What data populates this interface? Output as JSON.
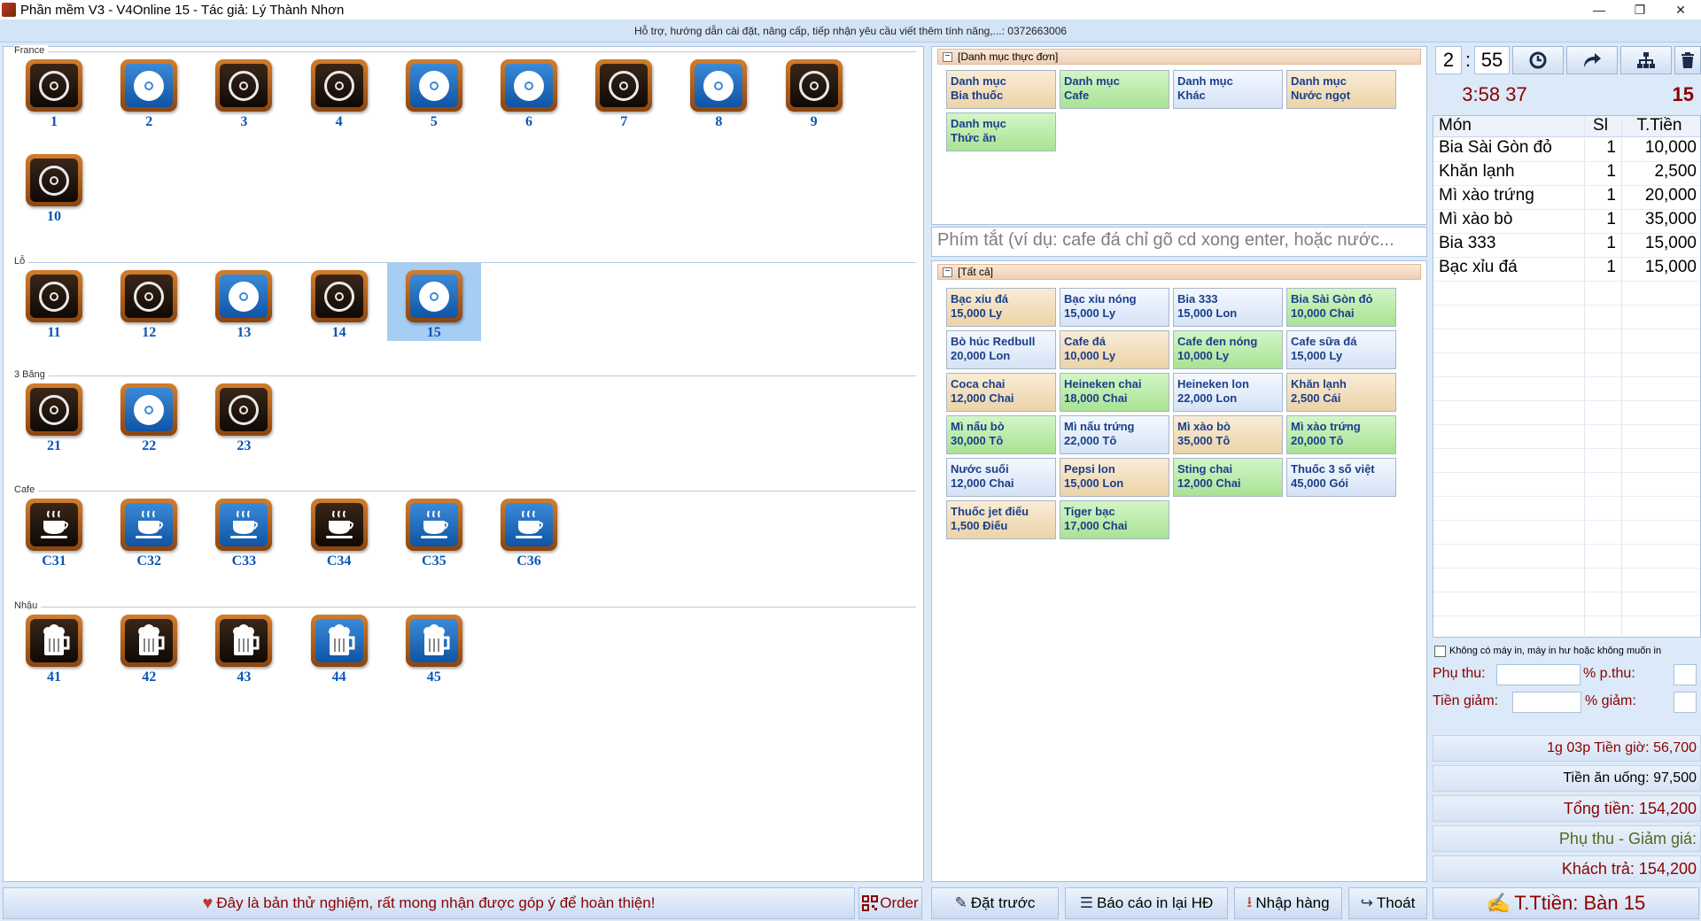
{
  "window": {
    "title": "Phần mềm V3 - V4Online 15 - Tác giả: Lý Thành Nhơn",
    "min_icon": "minimize-icon",
    "restore_icon": "restore-icon",
    "close_icon": "close-icon"
  },
  "infobar": {
    "text": "Hỗ trợ, hướng dẫn cài đặt, nâng cấp, tiếp nhận yêu cầu viết thêm tính năng,...: 0372663006"
  },
  "sections": [
    {
      "name": "France",
      "tables": [
        {
          "label": "1",
          "icon": "billiard-icon",
          "occupied": false
        },
        {
          "label": "2",
          "icon": "billiard-icon",
          "occupied": true
        },
        {
          "label": "3",
          "icon": "billiard-icon",
          "occupied": false
        },
        {
          "label": "4",
          "icon": "billiard-icon",
          "occupied": false
        },
        {
          "label": "5",
          "icon": "billiard-icon",
          "occupied": true
        },
        {
          "label": "6",
          "icon": "billiard-icon",
          "occupied": true
        },
        {
          "label": "7",
          "icon": "billiard-icon",
          "occupied": false
        },
        {
          "label": "8",
          "icon": "billiard-icon",
          "occupied": true
        },
        {
          "label": "9",
          "icon": "billiard-icon",
          "occupied": false
        },
        {
          "label": "10",
          "icon": "billiard-icon",
          "occupied": false
        }
      ]
    },
    {
      "name": "Lỗ",
      "tables": [
        {
          "label": "11",
          "icon": "billiard-icon",
          "occupied": false
        },
        {
          "label": "12",
          "icon": "billiard-icon",
          "occupied": false
        },
        {
          "label": "13",
          "icon": "billiard-icon",
          "occupied": true
        },
        {
          "label": "14",
          "icon": "billiard-icon",
          "occupied": false
        },
        {
          "label": "15",
          "icon": "billiard-icon",
          "occupied": true,
          "selected": true
        }
      ]
    },
    {
      "name": "3 Băng",
      "tables": [
        {
          "label": "21",
          "icon": "billiard-icon",
          "occupied": false
        },
        {
          "label": "22",
          "icon": "billiard-icon",
          "occupied": true
        },
        {
          "label": "23",
          "icon": "billiard-icon",
          "occupied": false
        }
      ]
    },
    {
      "name": "Cafe",
      "tables": [
        {
          "label": "C31",
          "icon": "coffee-cup-icon",
          "occupied": false
        },
        {
          "label": "C32",
          "icon": "coffee-cup-icon",
          "occupied": true
        },
        {
          "label": "C33",
          "icon": "coffee-cup-icon",
          "occupied": true
        },
        {
          "label": "C34",
          "icon": "coffee-cup-icon",
          "occupied": false
        },
        {
          "label": "C35",
          "icon": "coffee-cup-icon",
          "occupied": true
        },
        {
          "label": "C36",
          "icon": "coffee-cup-icon",
          "occupied": true
        }
      ]
    },
    {
      "name": "Nhậu",
      "tables": [
        {
          "label": "41",
          "icon": "beer-mug-icon",
          "occupied": false
        },
        {
          "label": "42",
          "icon": "beer-mug-icon",
          "occupied": false
        },
        {
          "label": "43",
          "icon": "beer-mug-icon",
          "occupied": false
        },
        {
          "label": "44",
          "icon": "beer-mug-icon",
          "occupied": true
        },
        {
          "label": "45",
          "icon": "beer-mug-icon",
          "occupied": true
        }
      ]
    }
  ],
  "menu_categories": {
    "header": "[Danh mục thực đơn]",
    "items": [
      {
        "line1": "Danh mục",
        "line2": "Bia thuốc",
        "color": "tan"
      },
      {
        "line1": "Danh mục",
        "line2": "Cafe",
        "color": "green"
      },
      {
        "line1": "Danh mục",
        "line2": "Khác",
        "color": "blue"
      },
      {
        "line1": "Danh mục",
        "line2": "Nước ngọt",
        "color": "tan"
      },
      {
        "line1": "Danh mục",
        "line2": "Thức ăn",
        "color": "green"
      }
    ]
  },
  "search": {
    "placeholder": "Phím tắt (ví dụ: cafe đá chỉ gõ cd xong enter, hoặc nước..."
  },
  "menu_items": {
    "header": "[Tất cả]",
    "items": [
      {
        "line1": "Bạc xỉu đá",
        "line2": "15,000 Ly",
        "color": "tan"
      },
      {
        "line1": "Bạc xỉu nóng",
        "line2": "15,000 Ly",
        "color": "blue"
      },
      {
        "line1": "Bia 333",
        "line2": "15,000 Lon",
        "color": "blue"
      },
      {
        "line1": "Bia Sài Gòn đỏ",
        "line2": "10,000 Chai",
        "color": "green"
      },
      {
        "line1": "Bò húc Redbull",
        "line2": "20,000 Lon",
        "color": "blue"
      },
      {
        "line1": "Cafe đá",
        "line2": "10,000 Ly",
        "color": "tan"
      },
      {
        "line1": "Cafe đen nóng",
        "line2": "10,000 Ly",
        "color": "green"
      },
      {
        "line1": "Cafe sữa đá",
        "line2": "15,000 Ly",
        "color": "blue"
      },
      {
        "line1": "Coca chai",
        "line2": "12,000 Chai",
        "color": "tan"
      },
      {
        "line1": "Heineken chai",
        "line2": "18,000 Chai",
        "color": "green"
      },
      {
        "line1": "Heineken lon",
        "line2": "22,000 Lon",
        "color": "blue"
      },
      {
        "line1": "Khăn lạnh",
        "line2": "2,500 Cái",
        "color": "tan"
      },
      {
        "line1": "Mì nấu bò",
        "line2": "30,000 Tô",
        "color": "green"
      },
      {
        "line1": "Mì nấu trứng",
        "line2": "22,000 Tô",
        "color": "blue"
      },
      {
        "line1": "Mì xào bò",
        "line2": "35,000 Tô",
        "color": "tan"
      },
      {
        "line1": "Mì xào trứng",
        "line2": "20,000 Tô",
        "color": "green"
      },
      {
        "line1": "Nước suối",
        "line2": "12,000 Chai",
        "color": "blue"
      },
      {
        "line1": "Pepsi lon",
        "line2": "15,000 Lon",
        "color": "tan"
      },
      {
        "line1": "Sting chai",
        "line2": "12,000 Chai",
        "color": "green"
      },
      {
        "line1": "Thuốc 3 số việt",
        "line2": "45,000 Gói",
        "color": "blue"
      },
      {
        "line1": "Thuốc jet điếu",
        "line2": "1,500 Điếu",
        "color": "tan"
      },
      {
        "line1": "Tiger bạc",
        "line2": "17,000 Chai",
        "color": "green"
      }
    ]
  },
  "timer": {
    "hours": "2",
    "sep": ":",
    "minutes": "55",
    "clock": "3:58 37",
    "table_number": "15"
  },
  "toolbar_icons": {
    "alarm": "alarm-clock-icon",
    "transfer": "transfer-arrow-icon",
    "merge": "merge-tables-icon",
    "delete": "trash-icon"
  },
  "order": {
    "headers": {
      "name": "Món",
      "qty": "Sl",
      "total": "T.Tiền"
    },
    "rows": [
      {
        "name": "Bia Sài Gòn đỏ",
        "qty": "1",
        "total": "10,000"
      },
      {
        "name": "Khăn lạnh",
        "qty": "1",
        "total": "2,500"
      },
      {
        "name": "Mì xào trứng",
        "qty": "1",
        "total": "20,000"
      },
      {
        "name": "Mì xào bò",
        "qty": "1",
        "total": "35,000"
      },
      {
        "name": "Bia 333",
        "qty": "1",
        "total": "15,000"
      },
      {
        "name": "Bạc xỉu đá",
        "qty": "1",
        "total": "15,000"
      }
    ]
  },
  "printer_check": "Không có máy in, máy in hư hoặc không muốn in",
  "fees": {
    "surcharge_label": "Phụ thu:",
    "surcharge_pct_label": "% p.thu:",
    "discount_label": "Tiền giảm:",
    "discount_pct_label": "% giảm:"
  },
  "summary": {
    "time_fee": "1g 03p Tiền giờ: 56,700",
    "food_fee": "Tiền ăn uống: 97,500",
    "total": "Tổng tiền: 154,200",
    "adjust": "Phụ thu - Giảm giá:",
    "pay": "Khách trả: 154,200"
  },
  "bottom": {
    "notice": "Đây là bản thử nghiệm, rất mong nhận được góp ý để hoàn thiện!",
    "order": "Order",
    "reserve": "Đặt trước",
    "report": "Báo cáo in lại HĐ",
    "import": "Nhập hàng",
    "exit": "Thoát",
    "checkout": "T.Ttiền: Bàn 15"
  },
  "colors": {
    "accent": "#0a55b8",
    "money": "#8b0000",
    "green_text": "#4b6b1f",
    "occupied_blue": "#1054a5"
  }
}
